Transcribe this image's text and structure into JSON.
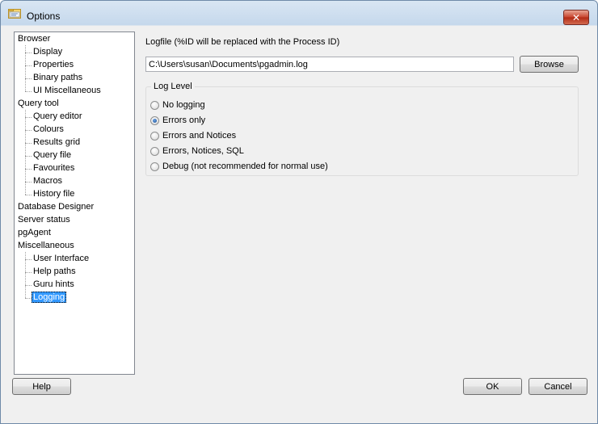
{
  "window": {
    "title": "Options",
    "close_label": "✕"
  },
  "tree": {
    "items": [
      {
        "label": "Browser",
        "level": 0
      },
      {
        "label": "Display",
        "level": 1
      },
      {
        "label": "Properties",
        "level": 1
      },
      {
        "label": "Binary paths",
        "level": 1
      },
      {
        "label": "UI Miscellaneous",
        "level": 1
      },
      {
        "label": "Query tool",
        "level": 0
      },
      {
        "label": "Query editor",
        "level": 1
      },
      {
        "label": "Colours",
        "level": 1
      },
      {
        "label": "Results grid",
        "level": 1
      },
      {
        "label": "Query file",
        "level": 1
      },
      {
        "label": "Favourites",
        "level": 1
      },
      {
        "label": "Macros",
        "level": 1
      },
      {
        "label": "History file",
        "level": 1
      },
      {
        "label": "Database Designer",
        "level": 0
      },
      {
        "label": "Server status",
        "level": 0
      },
      {
        "label": "pgAgent",
        "level": 0
      },
      {
        "label": "Miscellaneous",
        "level": 0
      },
      {
        "label": "User Interface",
        "level": 1
      },
      {
        "label": "Help paths",
        "level": 1
      },
      {
        "label": "Guru hints",
        "level": 1
      },
      {
        "label": "Logging",
        "level": 1,
        "selected": true
      }
    ]
  },
  "logging": {
    "logfile_label": "Logfile (%ID will be replaced with the Process ID)",
    "logfile_value": "C:\\Users\\susan\\Documents\\pgadmin.log",
    "browse_label": "Browse",
    "log_level_title": "Log Level",
    "options": [
      {
        "label": "No logging",
        "checked": false
      },
      {
        "label": "Errors only",
        "checked": true
      },
      {
        "label": "Errors and Notices",
        "checked": false
      },
      {
        "label": "Errors, Notices, SQL",
        "checked": false
      },
      {
        "label": "Debug (not recommended for normal use)",
        "checked": false
      }
    ]
  },
  "buttons": {
    "help": "Help",
    "ok": "OK",
    "cancel": "Cancel"
  }
}
